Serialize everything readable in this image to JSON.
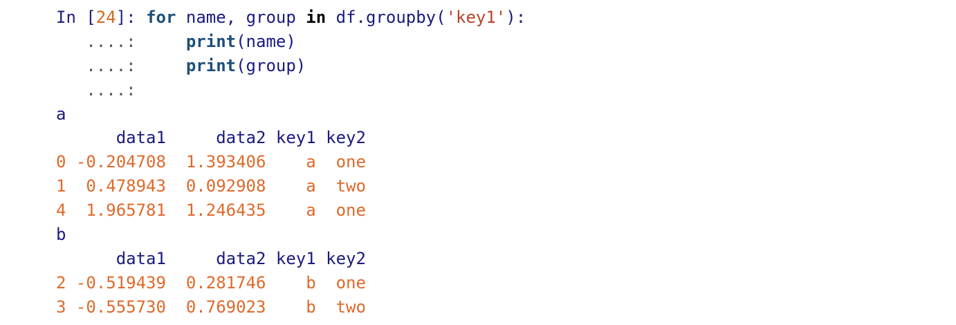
{
  "input": {
    "prompt_prefix": "In [",
    "prompt_number": "24",
    "prompt_suffix": "]: ",
    "kw_for": "for",
    "vars": " name, group ",
    "kw_in": "in",
    "call_prefix": " df.groupby(",
    "call_arg": "'key1'",
    "call_suffix": "):",
    "continuation": "   ....:     ",
    "continuation_last": "   ....:",
    "print_kw": "print",
    "print_arg_1": "(name)",
    "print_arg_2": "(group)"
  },
  "output": {
    "groups": [
      {
        "name": "a",
        "header": "      data1     data2 key1 key2",
        "rows": [
          {
            "index": "0",
            "values": " -0.204708  1.393406    a  one"
          },
          {
            "index": "1",
            "values": "  0.478943  0.092908    a  two"
          },
          {
            "index": "4",
            "values": "  1.965781  1.246435    a  one"
          }
        ]
      },
      {
        "name": "b",
        "header": "      data1     data2 key1 key2",
        "rows": [
          {
            "index": "2",
            "values": " -0.519439  0.281746    b  one"
          },
          {
            "index": "3",
            "values": " -0.555730  0.769023    b  two"
          }
        ]
      }
    ]
  }
}
